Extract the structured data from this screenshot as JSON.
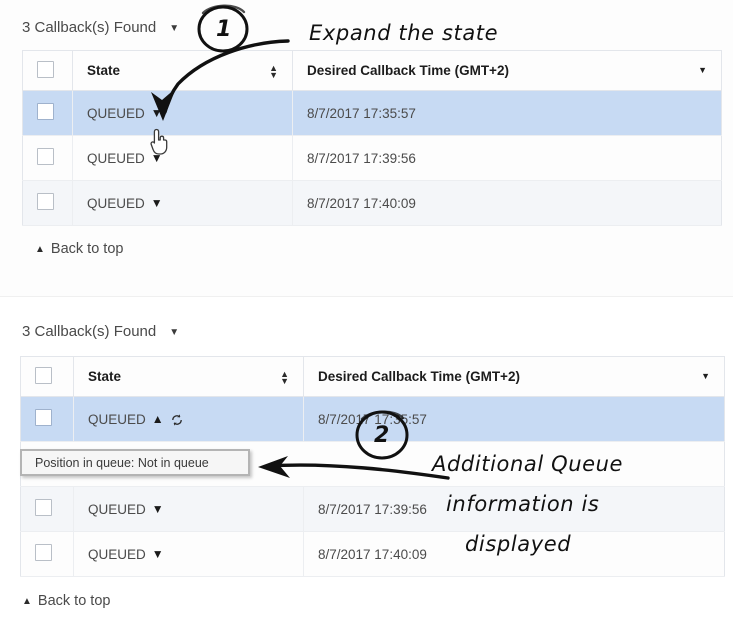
{
  "panels": [
    {
      "id": "top",
      "found_label": "3 Callback(s) Found",
      "found_caret": "▼",
      "columns": {
        "checkbox": "",
        "state": "State",
        "time": "Desired Callback Time (GMT+2)"
      },
      "sort_icon": "sort-updown-icon",
      "filter_icon": "filter-caret-icon",
      "rows": [
        {
          "state": "QUEUED",
          "chevron": "▼",
          "time": "8/7/2017 17:35:57",
          "selected": true,
          "expanded": false
        },
        {
          "state": "QUEUED",
          "chevron": "▼",
          "time": "8/7/2017 17:39:56",
          "selected": false,
          "expanded": false
        },
        {
          "state": "QUEUED",
          "chevron": "▼",
          "time": "8/7/2017 17:40:09",
          "selected": false,
          "expanded": false
        }
      ],
      "back_to_top": "Back to top",
      "back_caret": "▲"
    },
    {
      "id": "bottom",
      "found_label": "3 Callback(s) Found",
      "found_caret": "▼",
      "columns": {
        "checkbox": "",
        "state": "State",
        "time": "Desired Callback Time (GMT+2)"
      },
      "sort_icon": "sort-updown-icon",
      "filter_icon": "filter-caret-icon",
      "rows": [
        {
          "state": "QUEUED",
          "chevron": "▲",
          "time": "8/7/2017 17:35:57",
          "selected": true,
          "expanded": true,
          "refresh_icon": "refresh-icon"
        },
        {
          "state": "QUEUED",
          "chevron": "▼",
          "time": "8/7/2017 17:39:56",
          "selected": false,
          "expanded": false
        },
        {
          "state": "QUEUED",
          "chevron": "▼",
          "time": "8/7/2017 17:40:09",
          "selected": false,
          "expanded": false
        }
      ],
      "tooltip": "Position in queue: Not in queue",
      "back_to_top": "Back to top",
      "back_caret": "▲"
    }
  ],
  "annotations": {
    "badge_one": "1",
    "badge_two": "2",
    "callout_one": "Expand the state",
    "callout_two_line1": "Additional Queue",
    "callout_two_line2": "information is",
    "callout_two_line3": "displayed",
    "cursor_icon": "pointing-hand-cursor"
  },
  "colors": {
    "selected_row": "#c7daf3",
    "alt_row": "#f4f6f9",
    "grid_line": "#e3e6eb",
    "text": "#4b4b4b",
    "header_text": "#1c1c1c",
    "tooltip_bg": "#f6f6f6",
    "tooltip_border": "#b4b4b4",
    "annotation": "#111111"
  }
}
